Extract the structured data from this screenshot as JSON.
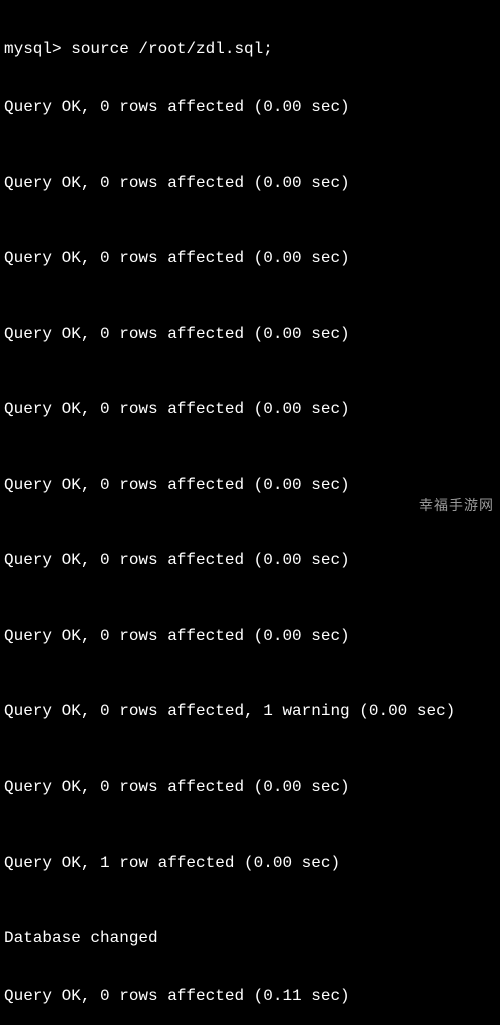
{
  "prompt": {
    "label": "mysql>",
    "command": "source /root/zdl.sql;"
  },
  "results": [
    "Query OK, 0 rows affected (0.00 sec)",
    "Query OK, 0 rows affected (0.00 sec)",
    "Query OK, 0 rows affected (0.00 sec)",
    "Query OK, 0 rows affected (0.00 sec)",
    "Query OK, 0 rows affected (0.00 sec)",
    "Query OK, 0 rows affected (0.00 sec)",
    "Query OK, 0 rows affected (0.00 sec)",
    "Query OK, 0 rows affected (0.00 sec)",
    "Query OK, 0 rows affected, 1 warning (0.00 sec)",
    "Query OK, 0 rows affected (0.00 sec)",
    "Query OK, 1 row affected (0.00 sec)"
  ],
  "db_changed": "Database changed",
  "final_result": "Query OK, 0 rows affected (0.11 sec)",
  "watermark": "幸福手游网"
}
